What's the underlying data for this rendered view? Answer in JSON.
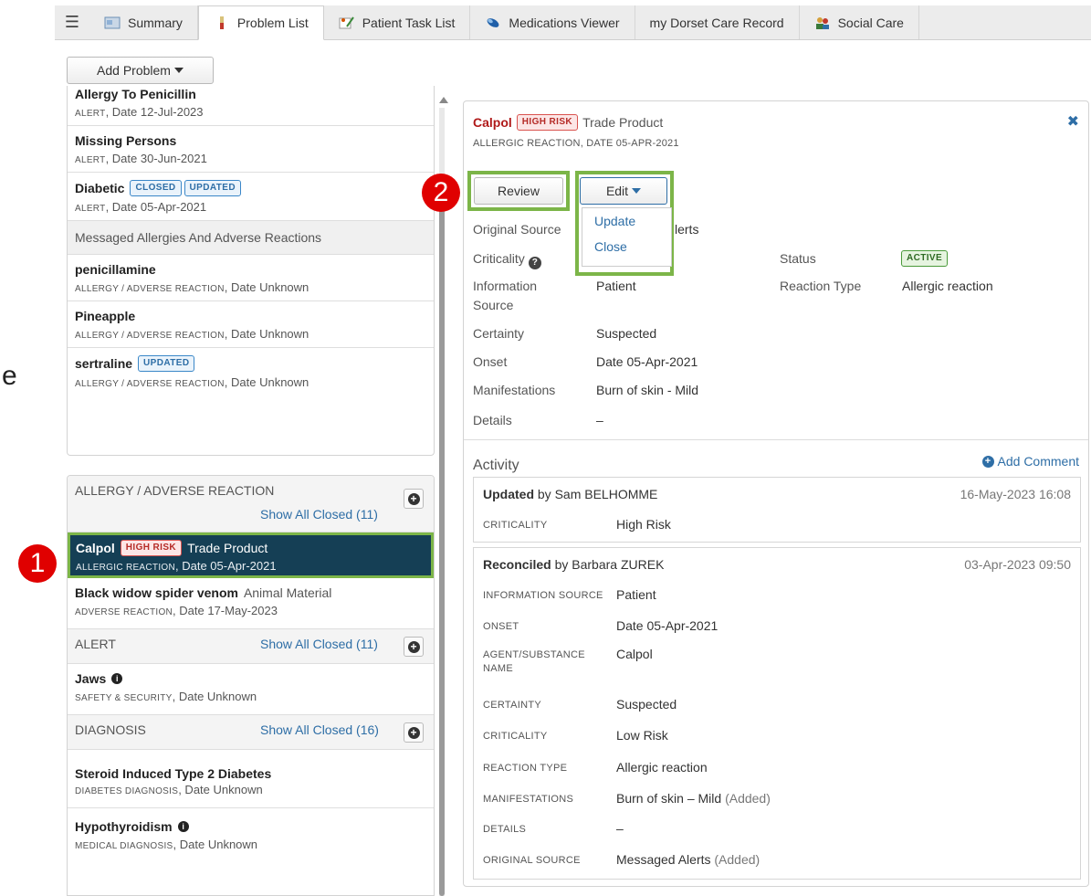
{
  "tabs": [
    {
      "label": "Summary",
      "icon": "summary-icon"
    },
    {
      "label": "Problem List",
      "icon": "problem-list-icon"
    },
    {
      "label": "Patient Task List",
      "icon": "task-list-icon"
    },
    {
      "label": "Medications Viewer",
      "icon": "medications-icon"
    },
    {
      "label": "my Dorset Care Record",
      "icon": ""
    },
    {
      "label": "Social Care",
      "icon": "social-care-icon"
    }
  ],
  "toolbar": {
    "add_problem": "Add Problem"
  },
  "stray_letter": "e",
  "markers": {
    "one": "1",
    "two": "2"
  },
  "top_list": {
    "items": [
      {
        "title": "Allergy To Penicillin",
        "sub_small": "ALERT",
        "sub": ", Date 12-Jul-2023"
      },
      {
        "title": "Missing Persons",
        "sub_small": "ALERT",
        "sub": ", Date 30-Jun-2021"
      },
      {
        "title": "Diabetic",
        "badge1": "CLOSED",
        "badge2": "UPDATED",
        "sub_small": "ALERT",
        "sub": ", Date 05-Apr-2021"
      }
    ],
    "group_header": "Messaged Allergies And Adverse Reactions",
    "messaged": [
      {
        "title": "penicillamine",
        "sub_small": "ALLERGY / ADVERSE REACTION",
        "sub": ", Date Unknown"
      },
      {
        "title": "Pineapple",
        "sub_small": "ALLERGY / ADVERSE REACTION",
        "sub": ", Date Unknown"
      },
      {
        "title": "sertraline",
        "badge": "UPDATED",
        "sub_small": "ALLERGY / ADVERSE REACTION",
        "sub": ", Date Unknown"
      }
    ]
  },
  "bottom_list": {
    "allergy_cat": "ALLERGY / ADVERSE REACTION",
    "allergy_show": "Show All Closed (11)",
    "selected": {
      "name": "Calpol",
      "badge": "HIGH RISK",
      "material": "Trade Product",
      "sub_small": "ALLERGIC REACTION",
      "sub": ", Date 05-Apr-2021"
    },
    "spider": {
      "name": "Black widow spider venom",
      "material": "Animal Material",
      "sub_small": "ADVERSE REACTION",
      "sub": ", Date 17-May-2023"
    },
    "alert_cat": "ALERT",
    "alert_show": "Show All Closed (11)",
    "jaws": {
      "name": "Jaws",
      "sub_small": "SAFETY & SECURITY",
      "sub": ", Date Unknown"
    },
    "diag_cat": "DIAGNOSIS",
    "diag_show": "Show All Closed (16)",
    "steroid": {
      "name": "Steroid Induced Type 2 Diabetes",
      "sub_small": "DIABETES DIAGNOSIS",
      "sub": ", Date Unknown"
    },
    "hypo": {
      "name": "Hypothyroidism",
      "sub_small": "MEDICAL DIAGNOSIS",
      "sub": ", Date Unknown"
    }
  },
  "detail": {
    "name": "Calpol",
    "badge": "HIGH RISK",
    "material": "Trade Product",
    "subtitle": "ALLERGIC REACTION, DATE 05-APR-2021",
    "review": "Review",
    "edit": "Edit",
    "menu": [
      "Update",
      "Close"
    ],
    "fields": {
      "original_source_label": "Original Source",
      "original_source_value": "lerts",
      "criticality_label": "Criticality",
      "status_label": "Status",
      "status_value": "ACTIVE",
      "info_source_label1": "Information",
      "info_source_label2": "Source",
      "info_source_value": "Patient",
      "reaction_type_label": "Reaction Type",
      "reaction_type_value": "Allergic reaction",
      "certainty_label": "Certainty",
      "certainty_value": "Suspected",
      "onset_label": "Onset",
      "onset_value": "Date 05-Apr-2021",
      "manifestations_label": "Manifestations",
      "manifestations_value": "Burn of skin - Mild",
      "details_label": "Details",
      "details_value": "–"
    },
    "activity_title": "Activity",
    "add_comment": "Add Comment",
    "activity": [
      {
        "action": "Updated",
        "by": "by Sam BELHOMME",
        "time": "16-May-2023 16:08",
        "rows": [
          {
            "k": "CRITICALITY",
            "v": "High Risk"
          }
        ]
      },
      {
        "action": "Reconciled",
        "by": "by Barbara ZUREK",
        "time": "03-Apr-2023 09:50",
        "rows": [
          {
            "k": "INFORMATION SOURCE",
            "v": "Patient"
          },
          {
            "k": "ONSET",
            "v": "Date 05-Apr-2021"
          },
          {
            "k": "AGENT/SUBSTANCE",
            "k2": "NAME",
            "v": "Calpol"
          },
          {
            "k": "CERTAINTY",
            "v": "Suspected"
          },
          {
            "k": "CRITICALITY",
            "v": "Low Risk"
          },
          {
            "k": "REACTION TYPE",
            "v": "Allergic reaction"
          },
          {
            "k": "MANIFESTATIONS",
            "v": "Burn of skin – Mild",
            "note": "(Added)"
          },
          {
            "k": "DETAILS",
            "v": "–"
          },
          {
            "k": "ORIGINAL SOURCE",
            "v": "Messaged Alerts",
            "note": "(Added)"
          }
        ]
      }
    ]
  },
  "colors": {
    "highlight": "#7cb548",
    "selected_bg": "#153f55",
    "marker": "#e00000",
    "link": "#2e6ea6",
    "danger": "#b01a1a"
  }
}
